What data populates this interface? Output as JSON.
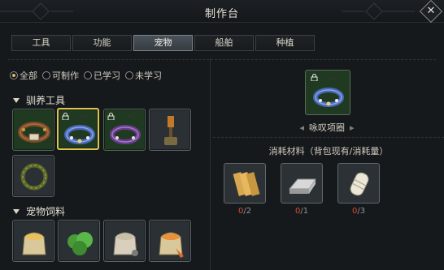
{
  "window": {
    "title": "制作台"
  },
  "tabs": [
    {
      "label": "工具",
      "active": false
    },
    {
      "label": "功能",
      "active": false
    },
    {
      "label": "宠物",
      "active": true
    },
    {
      "label": "船舶",
      "active": false
    },
    {
      "label": "种植",
      "active": false
    }
  ],
  "filters": [
    {
      "label": "全部",
      "selected": true
    },
    {
      "label": "可制作",
      "selected": false
    },
    {
      "label": "已学习",
      "selected": false
    },
    {
      "label": "未学习",
      "selected": false
    }
  ],
  "categories": [
    {
      "title": "驯养工具",
      "items": [
        {
          "icon": "brown-collar-icon",
          "state": "craftable"
        },
        {
          "icon": "blue-collar-icon",
          "state": "selected",
          "locked": true
        },
        {
          "icon": "purple-collar-icon",
          "state": "craftable",
          "locked": true
        },
        {
          "icon": "torch-lure-icon",
          "state": "normal"
        },
        {
          "icon": "leaf-wreath-icon",
          "state": "normal"
        }
      ]
    },
    {
      "title": "宠物饲料",
      "items": [
        {
          "icon": "grain-sack-icon",
          "state": "normal"
        },
        {
          "icon": "green-feed-icon",
          "state": "normal"
        },
        {
          "icon": "stone-sack-icon",
          "state": "normal"
        },
        {
          "icon": "carrot-sack-icon",
          "state": "normal"
        }
      ]
    }
  ],
  "detail": {
    "item_name": "咏叹项圈",
    "item_icon": "blue-collar-icon",
    "locked": true,
    "prev_arrow": "◂",
    "next_arrow": "▸",
    "materials_title": "消耗材料（背包现有/消耗量）",
    "materials": [
      {
        "icon": "wood-planks-icon",
        "have": "0",
        "need": "2"
      },
      {
        "icon": "iron-ingot-icon",
        "have": "0",
        "need": "1"
      },
      {
        "icon": "cloth-roll-icon",
        "have": "0",
        "need": "3"
      }
    ]
  },
  "colors": {
    "accent": "#d8c84a",
    "lacking": "#d84a3c",
    "craftable_bg": "#203a22"
  }
}
